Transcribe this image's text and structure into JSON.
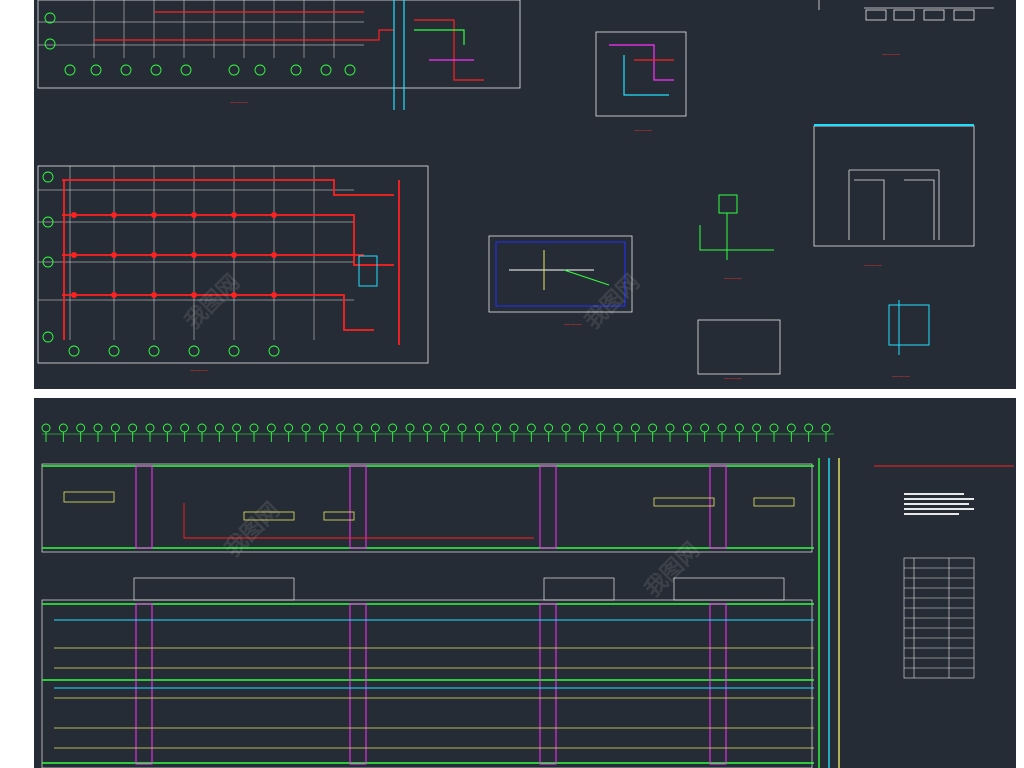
{
  "watermark": "我图网",
  "colors": {
    "background": "#262c35",
    "page": "#ffffff",
    "wire_red": "#ff2020",
    "wire_cyan": "#20e0ff",
    "wire_green": "#30ff40",
    "wire_magenta": "#ff30ff",
    "wire_yellow": "#e8e860",
    "frame_white": "#e8e8e8"
  },
  "top_sheet": {
    "axis_labels_1": [
      "A",
      "11",
      "16",
      "21",
      "26",
      "31",
      "36",
      "41"
    ],
    "axis_labels_2": [
      "G",
      "F",
      "E",
      "D",
      "C",
      "B",
      "A"
    ],
    "axis_labels_3": [
      "A",
      "11",
      "16",
      "21",
      "26",
      "31"
    ],
    "grid_rows": [
      "G",
      "F",
      "E",
      "A"
    ],
    "unit_label": "?"
  },
  "bottom_sheet": {
    "axis_labels": [
      "1",
      "2",
      "3",
      "4",
      "5",
      "6",
      "7",
      "8",
      "9",
      "10",
      "11",
      "12",
      "13",
      "14",
      "15",
      "16",
      "17",
      "18",
      "19",
      "20",
      "21",
      "22",
      "23",
      "24",
      "25",
      "26",
      "27",
      "28",
      "29",
      "30",
      "31",
      "32",
      "33",
      "34",
      "35",
      "36",
      "37",
      "38",
      "39",
      "40",
      "41",
      "42",
      "43",
      "44",
      "45",
      "46"
    ]
  }
}
